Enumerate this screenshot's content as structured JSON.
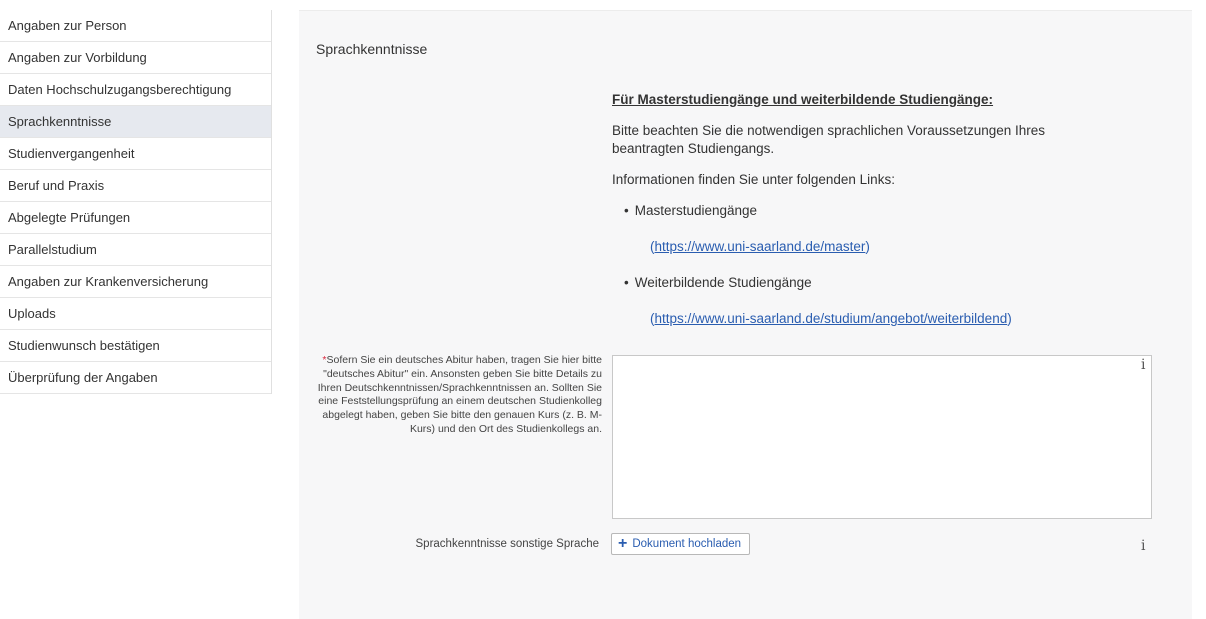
{
  "sidebar": {
    "items": [
      {
        "label": "Angaben zur Person",
        "active": false
      },
      {
        "label": "Angaben zur Vorbildung",
        "active": false
      },
      {
        "label": "Daten Hochschulzugangsberechtigung",
        "active": false
      },
      {
        "label": "Sprachkenntnisse",
        "active": true
      },
      {
        "label": "Studienvergangenheit",
        "active": false
      },
      {
        "label": "Beruf und Praxis",
        "active": false
      },
      {
        "label": "Abgelegte Prüfungen",
        "active": false
      },
      {
        "label": "Parallelstudium",
        "active": false
      },
      {
        "label": "Angaben zur Krankenversicherung",
        "active": false
      },
      {
        "label": "Uploads",
        "active": false
      },
      {
        "label": "Studienwunsch bestätigen",
        "active": false
      },
      {
        "label": "Überprüfung der Angaben",
        "active": false
      }
    ]
  },
  "main": {
    "section_title": "Sprachkenntnisse",
    "info": {
      "heading": "Für Masterstudiengänge und weiterbildende Studiengänge:",
      "paragraph1": "Bitte beachten Sie die notwendigen sprachlichen Voraussetzungen Ihres beantragten Studiengangs.",
      "paragraph2": "Informationen finden Sie unter folgenden Links:",
      "links": [
        {
          "label": "Masterstudiengänge",
          "url_text": "https://www.uni-saarland.de/master"
        },
        {
          "label": "Weiterbildende Studiengänge",
          "url_text": "https://www.uni-saarland.de/studium/angebot/weiterbildend"
        }
      ]
    },
    "form": {
      "german_field": {
        "required_marker": "*",
        "label": "Sofern Sie ein deutsches Abitur haben, tragen Sie hier bitte \"deutsches Abitur\" ein. Ansonsten geben Sie bitte Details zu Ihren Deutschkenntnissen/Sprachkenntnissen an. Sollten Sie eine Feststellungsprüfung an einem deutschen Studienkolleg abgelegt haben, geben Sie bitte den genauen Kurs (z. B. M-Kurs) und den Ort des Studienkollegs an.",
        "value": "",
        "info_icon": "i"
      },
      "other_language": {
        "label": "Sprachkenntnisse sonstige Sprache",
        "button_label": "Dokument hochladen",
        "button_icon": "+",
        "info_icon": "i"
      }
    }
  },
  "colors": {
    "link": "#2a5db0",
    "active_item_bg": "#e6e9ef",
    "panel_bg": "#f7f7f8",
    "required": "#d9263c"
  }
}
